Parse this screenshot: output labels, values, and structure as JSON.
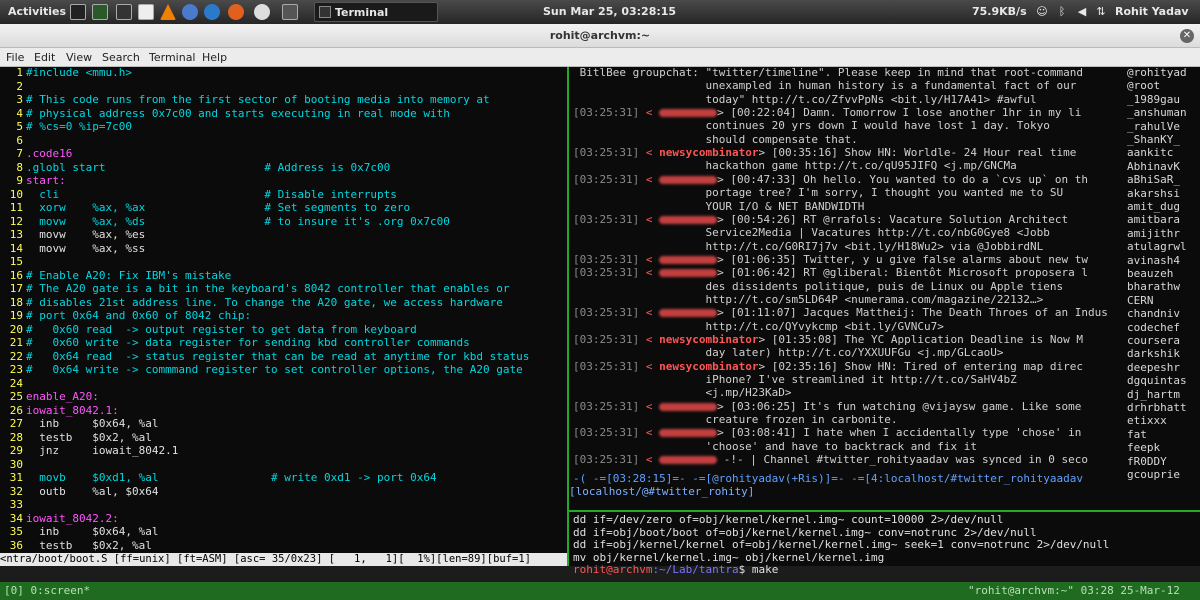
{
  "topbar": {
    "activities": "Activities",
    "task": "Terminal",
    "clock": "Sun Mar 25, 03:28:15",
    "net": "75.9KB/s",
    "user": "Rohit Yadav"
  },
  "window": {
    "title": "rohit@archvm:~"
  },
  "menu": [
    "File",
    "Edit",
    "View",
    "Search",
    "Terminal",
    "Help"
  ],
  "vim": {
    "status": "<ntra/boot/boot.S [ff=unix] [ft=ASM] [asc= 35/0x23] [   1,   1][  1%][len=89][buf=1]"
  },
  "code_lines": [
    {
      "n": "1",
      "t": "#include <mmu.h>",
      "cls": "c"
    },
    {
      "n": "2",
      "t": "",
      "cls": "w"
    },
    {
      "n": "3",
      "t": "# This code runs from the first sector of booting media into memory at",
      "cls": "c"
    },
    {
      "n": "4",
      "t": "# physical address 0x7c00 and starts executing in real mode with",
      "cls": "c"
    },
    {
      "n": "5",
      "t": "# %cs=0 %ip=7c00",
      "cls": "c"
    },
    {
      "n": "6",
      "t": "",
      "cls": "w"
    },
    {
      "n": "7",
      "t": ".code16",
      "cls": "k"
    },
    {
      "n": "8",
      "t": ".globl start                        # Address is 0x7c00",
      "cls": "c"
    },
    {
      "n": "9",
      "t": "start:",
      "cls": "k"
    },
    {
      "n": "10",
      "t": "  cli                               # Disable interrupts",
      "cls": "c"
    },
    {
      "n": "11",
      "t": "  xorw    %ax, %ax                  # Set segments to zero",
      "cls": "c"
    },
    {
      "n": "12",
      "t": "  movw    %ax, %ds                  # to insure it's .org 0x7c00",
      "cls": "c"
    },
    {
      "n": "13",
      "t": "  movw    %ax, %es",
      "cls": "w"
    },
    {
      "n": "14",
      "t": "  movw    %ax, %ss",
      "cls": "w"
    },
    {
      "n": "15",
      "t": "",
      "cls": "w"
    },
    {
      "n": "16",
      "t": "# Enable A20: Fix IBM's mistake",
      "cls": "c"
    },
    {
      "n": "17",
      "t": "# The A20 gate is a bit in the keyboard's 8042 controller that enables or",
      "cls": "c"
    },
    {
      "n": "18",
      "t": "# disables 21st address line. To change the A20 gate, we access hardware",
      "cls": "c"
    },
    {
      "n": "19",
      "t": "# port 0x64 and 0x60 of 8042 chip:",
      "cls": "c"
    },
    {
      "n": "20",
      "t": "#   0x60 read  -> output register to get data from keyboard",
      "cls": "c"
    },
    {
      "n": "21",
      "t": "#   0x60 write -> data register for sending kbd controller commands",
      "cls": "c"
    },
    {
      "n": "22",
      "t": "#   0x64 read  -> status register that can be read at anytime for kbd status",
      "cls": "c"
    },
    {
      "n": "23",
      "t": "#   0x64 write -> commmand register to set controller options, the A20 gate",
      "cls": "c"
    },
    {
      "n": "24",
      "t": "",
      "cls": "w"
    },
    {
      "n": "25",
      "t": "enable_A20:",
      "cls": "k"
    },
    {
      "n": "26",
      "t": "iowait_8042.1:",
      "cls": "k"
    },
    {
      "n": "27",
      "t": "  inb     $0x64, %al",
      "cls": "w"
    },
    {
      "n": "28",
      "t": "  testb   $0x2, %al",
      "cls": "w"
    },
    {
      "n": "29",
      "t": "  jnz     iowait_8042.1",
      "cls": "w"
    },
    {
      "n": "30",
      "t": "",
      "cls": "w"
    },
    {
      "n": "31",
      "t": "  movb    $0xd1, %al                 # write 0xd1 -> port 0x64",
      "cls": "c"
    },
    {
      "n": "32",
      "t": "  outb    %al, $0x64",
      "cls": "w"
    },
    {
      "n": "33",
      "t": "",
      "cls": "w"
    },
    {
      "n": "34",
      "t": "iowait_8042.2:",
      "cls": "k"
    },
    {
      "n": "35",
      "t": "  inb     $0x64, %al",
      "cls": "w"
    },
    {
      "n": "36",
      "t": "  testb   $0x2, %al",
      "cls": "w"
    }
  ],
  "irc_lines": [
    {
      "ts": "",
      "nick": "",
      "t": " BitlBee groupchat: \"twitter/timeline\". Please keep in mind that root-command"
    },
    {
      "ts": "",
      "nick": "",
      "t": "                    unexampled in human history is a fundamental fact of our"
    },
    {
      "ts": "",
      "nick": "",
      "t": "                    today\" http://t.co/ZfvvPpNs <bit.ly/H17A41> #awful"
    },
    {
      "ts": "[03:25:31]",
      "nick": "",
      "t": "> [00:22:04] Damn. Tomorrow I lose another 1hr in my li"
    },
    {
      "ts": "",
      "nick": "",
      "t": "                    continues 20 yrs down I would have lost 1 day. Tokyo"
    },
    {
      "ts": "",
      "nick": "",
      "t": "                    should compensate that."
    },
    {
      "ts": "[03:25:31]",
      "nick": "newsycombinator",
      "t": "> [00:35:16] Show HN: Worldle- 24 Hour real time"
    },
    {
      "ts": "",
      "nick": "",
      "t": "                    hackathon game http://t.co/qU95JIFQ <j.mp/GNCMa"
    },
    {
      "ts": "[03:25:31]",
      "nick": "",
      "t": "> [00:47:33] Oh hello. You wanted to do a `cvs up` on th"
    },
    {
      "ts": "",
      "nick": "",
      "t": "                    portage tree? I'm sorry, I thought you wanted me to SU"
    },
    {
      "ts": "",
      "nick": "",
      "t": "                    YOUR I/O & NET BANDWIDTH"
    },
    {
      "ts": "[03:25:31]",
      "nick": "",
      "t": "> [00:54:26] RT @rrafols: Vacature Solution Architect"
    },
    {
      "ts": "",
      "nick": "",
      "t": "                    Service2Media | Vacatures http://t.co/nbG0Gye8 <Jobb"
    },
    {
      "ts": "",
      "nick": "",
      "t": "                    http://t.co/G0RI7j7v <bit.ly/H18Wu2> via @JobbirdNL"
    },
    {
      "ts": "[03:25:31]",
      "nick": "",
      "t": "> [01:06:35] Twitter, y u give false alarms about new tw"
    },
    {
      "ts": "[03:25:31]",
      "nick": "",
      "t": "> [01:06:42] RT @gliberal: Bientôt Microsoft proposera l"
    },
    {
      "ts": "",
      "nick": "",
      "t": "                    des dissidents politique, puis de Linux ou Apple tiens"
    },
    {
      "ts": "",
      "nick": "",
      "t": "                    http://t.co/sm5LD64P <numerama.com/magazine/22132…>"
    },
    {
      "ts": "[03:25:31]",
      "nick": "",
      "t": "> [01:11:07] Jacques Mattheij: The Death Throes of an Indus"
    },
    {
      "ts": "",
      "nick": "",
      "t": "                    http://t.co/QYvykcmp <bit.ly/GVNCu7>"
    },
    {
      "ts": "[03:25:31]",
      "nick": "newsycombinator",
      "t": "> [01:35:08] The YC Application Deadline is Now M"
    },
    {
      "ts": "",
      "nick": "",
      "t": "                    day later) http://t.co/YXXUUFGu <j.mp/GLcaoU>"
    },
    {
      "ts": "[03:25:31]",
      "nick": "newsycombinator",
      "t": "> [02:35:16] Show HN: Tired of entering map direc"
    },
    {
      "ts": "",
      "nick": "",
      "t": "                    iPhone? I've streamlined it http://t.co/SaHV4bZ"
    },
    {
      "ts": "",
      "nick": "",
      "t": "                    <j.mp/H23KaD>"
    },
    {
      "ts": "[03:25:31]",
      "nick": "",
      "t": "> [03:06:25] It's fun watching @vijaysw game. Like some"
    },
    {
      "ts": "",
      "nick": "",
      "t": "                    creature frozen in carbonite."
    },
    {
      "ts": "[03:25:31]",
      "nick": "",
      "t": "> [03:08:41] I hate when I accidentally type 'chose' in"
    },
    {
      "ts": "",
      "nick": "",
      "t": "                    'choose' and have to backtrack and fix it"
    },
    {
      "ts": "[03:25:31]",
      "nick": "",
      "t": " -!- | Channel #twitter_rohityaadav was synced in 0 seco"
    }
  ],
  "nicklist": [
    "@rohityad",
    "@root",
    "_1989gau",
    "_anshuman",
    "_rahulVe",
    "_ShanKY_",
    "aankitc",
    "AbhinavK",
    "aBhiSaR_",
    "akarshsi",
    "amit_dug",
    "amitbara",
    "amijithr",
    "atulagrwl",
    "avinash4",
    "beauzeh",
    "bharathw",
    "CERN",
    "chandniv",
    "codechef",
    "coursera",
    "darkshik",
    "deepeshr",
    "dgquintas",
    "dj_hartm",
    "drhrbhatt",
    "etixxx",
    "fat",
    "feepk",
    "fR0DDY",
    "gcouprie"
  ],
  "irc_status": {
    "line1": "-( -=[03:28:15]=- -=[@rohityadav(+Ris)]=- -=[4:localhost/#twitter_rohityaadav",
    "line2": "[localhost/@#twitter_rohity]"
  },
  "shell_lines": [
    "dd if=/dev/zero of=obj/kernel/kernel.img~ count=10000 2>/dev/null",
    "dd if=obj/boot/boot of=obj/kernel/kernel.img~ conv=notrunc 2>/dev/null",
    "dd if=obj/kernel/kernel of=obj/kernel/kernel.img~ seek=1 conv=notrunc 2>/dev/null",
    "mv obj/kernel/kernel.img~ obj/kernel/kernel.img"
  ],
  "prompt": {
    "user": "rohit@archvm",
    "path": ":~/Lab/tantra",
    "cmd": "$ make"
  },
  "screenbar": {
    "left": "[0] 0:screen*",
    "right": "\"rohit@archvm:~\" 03:28 25-Mar-12"
  }
}
